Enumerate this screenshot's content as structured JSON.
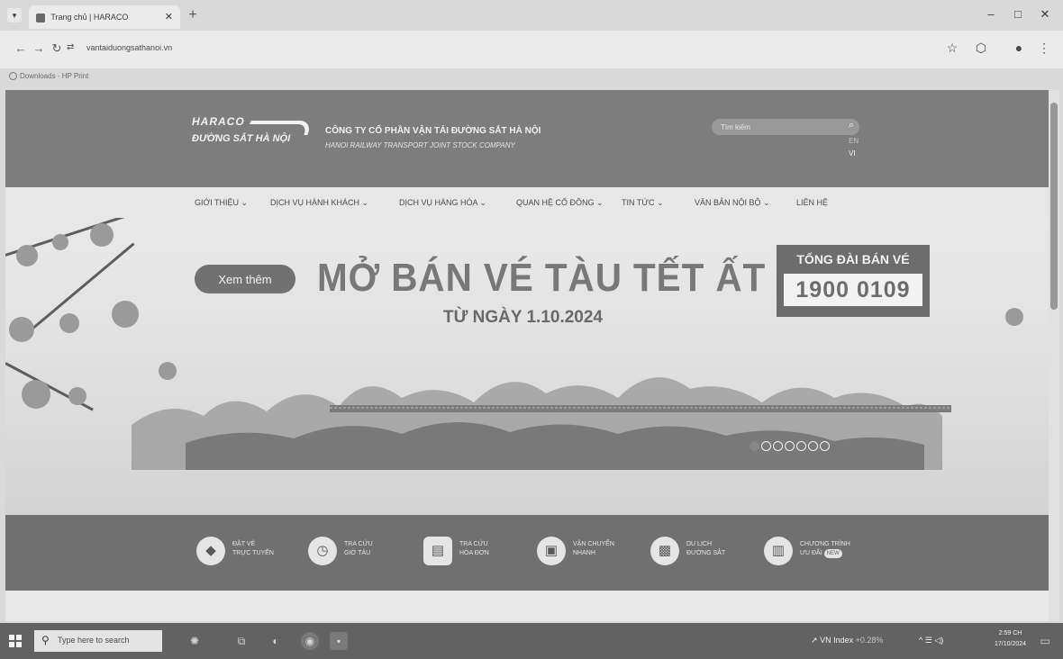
{
  "browser": {
    "tab_title": "Trang chủ | HARACO",
    "url": "vantaiduongsathanoi.vn",
    "bookmark": "Downloads - HP Print"
  },
  "site": {
    "logo_top": "HARACO",
    "logo_bottom": "ĐƯỜNG SẮT HÀ NỘI",
    "company_vn": "CÔNG TY CỔ PHẦN VẬN TẢI ĐƯỜNG SẮT HÀ NỘI",
    "company_en": "HANOI RAILWAY TRANSPORT JOINT STOCK COMPANY",
    "search_placeholder": "Tìm kiếm",
    "lang_en": "EN",
    "lang_vi": "VI"
  },
  "nav": [
    {
      "label": "GIỚI THIỆU ⌄"
    },
    {
      "label": "DỊCH VỤ HÀNH KHÁCH ⌄"
    },
    {
      "label": "DỊCH VỤ HÀNG HÓA ⌄"
    },
    {
      "label": "QUAN HỆ CỔ ĐÔNG ⌄"
    },
    {
      "label": "TIN TỨC ⌄"
    },
    {
      "label": "VĂN BẢN NỘI BỘ ⌄"
    },
    {
      "label": "LIÊN HỆ"
    }
  ],
  "hero": {
    "button": "Xem thêm",
    "title": "MỞ BÁN VÉ TÀU TẾT ẤT TỴ",
    "subtitle": "TỪ NGÀY 1.10.2024",
    "hotline_label": "TỔNG ĐÀI BÁN VÉ",
    "hotline_number": "1900 0109",
    "slide_count": 7,
    "active_slide": 1
  },
  "services": [
    {
      "icon": "train-ticket-icon",
      "line1": "ĐẶT VÉ",
      "line2": "TRỰC TUYẾN",
      "badge": ""
    },
    {
      "icon": "clock-icon",
      "line1": "TRA CỨU",
      "line2": "GIỜ TÀU",
      "badge": ""
    },
    {
      "icon": "invoice-search-icon",
      "line1": "TRA CỨU",
      "line2": "HÓA ĐƠN",
      "badge": ""
    },
    {
      "icon": "delivery-box-icon",
      "line1": "VẬN CHUYỂN",
      "line2": "NHANH",
      "badge": ""
    },
    {
      "icon": "train-icon",
      "line1": "DU LỊCH",
      "line2": "ĐƯỜNG SẮT",
      "badge": ""
    },
    {
      "icon": "gift-icon",
      "line1": "CHƯƠNG TRÌNH",
      "line2": "ƯU ĐÃI",
      "badge": "NEW"
    }
  ],
  "taskbar": {
    "search_placeholder": "Type here to search",
    "vn_index": "VN Index",
    "vn_change": "+0.28%",
    "time": "2:59 CH",
    "date": "17/10/2024"
  },
  "colors": {
    "header_bg": "#7d7d7d",
    "services_bg": "#6e6e6e",
    "hotline_bg": "#6a6a6a"
  }
}
